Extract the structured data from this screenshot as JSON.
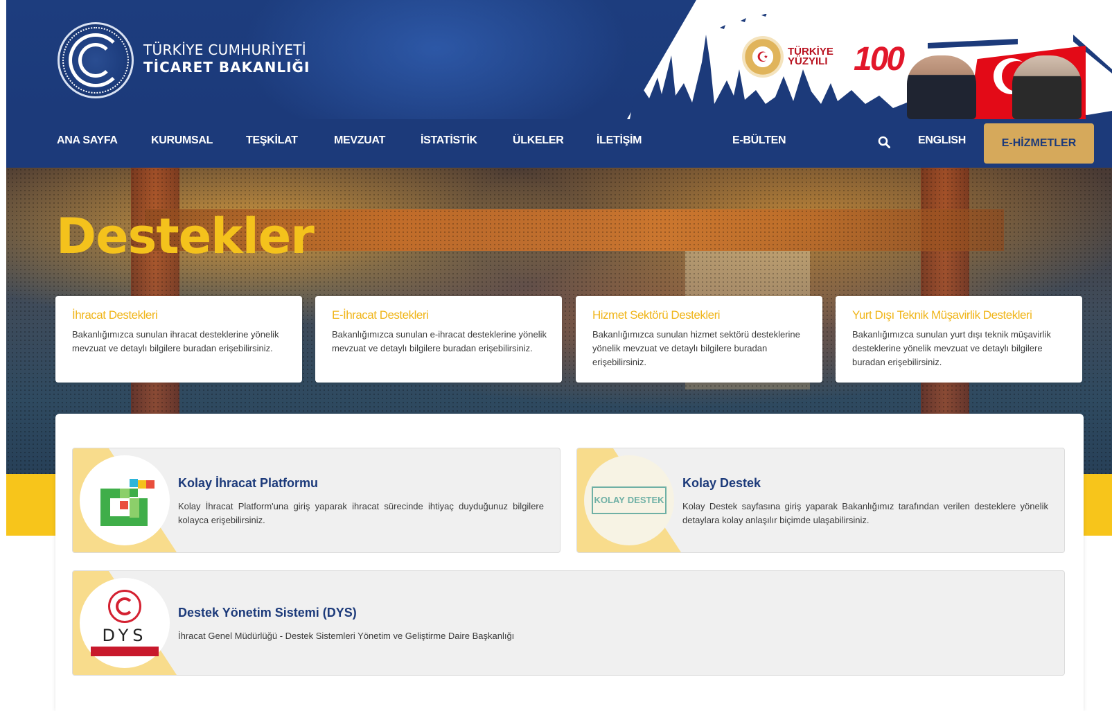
{
  "header": {
    "org_line1": "TÜRKİYE CUMHURİYETİ",
    "org_line2": "TİCARET BAKANLIĞI",
    "banner": {
      "badge_line1": "TÜRKİYE",
      "badge_line2": "YÜZYILI",
      "badge_number": "100"
    }
  },
  "nav": {
    "items": [
      {
        "label": "ANA SAYFA"
      },
      {
        "label": "KURUMSAL"
      },
      {
        "label": "TEŞKİLAT"
      },
      {
        "label": "MEVZUAT"
      },
      {
        "label": "İSTATİSTİK"
      },
      {
        "label": "ÜLKELER"
      },
      {
        "label": "İLETİŞİM"
      },
      {
        "label": "E-BÜLTEN"
      }
    ],
    "search_icon": "search-icon",
    "english": "ENGLISH",
    "ehizmetler": "E-HİZMETLER"
  },
  "hero": {
    "title": "Destekler"
  },
  "cards": [
    {
      "title": "İhracat Destekleri",
      "desc": "Bakanlığımızca sunulan ihracat desteklerine yönelik mevzuat ve detaylı bilgilere buradan erişebilirsiniz."
    },
    {
      "title": "E-İhracat Destekleri",
      "desc": "Bakanlığımızca sunulan e-ihracat desteklerine yönelik mevzuat ve detaylı bilgilere buradan erişebilirsiniz."
    },
    {
      "title": "Hizmet Sektörü Destekleri",
      "desc": "Bakanlığımızca sunulan hizmet sektörü desteklerine yönelik mevzuat ve detaylı bilgilere buradan erişebilirsiniz."
    },
    {
      "title": "Yurt Dışı Teknik Müşavirlik Destekleri",
      "desc": "Bakanlığımızca sunulan yurt dışı teknik müşavirlik desteklerine yönelik mevzuat ve detaylı bilgilere buradan erişebilirsiniz."
    }
  ],
  "platforms": [
    {
      "title": "Kolay İhracat Platformu",
      "desc": "Kolay İhracat Platform'una giriş yaparak ihracat sürecinde ihtiyaç duyduğunuz bilgilere kolayca erişebilirsiniz."
    },
    {
      "title": "Kolay Destek",
      "desc": "Kolay Destek sayfasına giriş yaparak Bakanlığımız tarafından verilen desteklere yönelik detaylara kolay anlaşılır biçimde ulaşabilirsiniz.",
      "logo_line1": "KOLAY",
      "logo_line2": "DESTEK"
    },
    {
      "title": "Destek Yönetim Sistemi (DYS)",
      "desc": "İhracat Genel Müdürlüğü - Destek Sistemleri Yönetim ve Geliştirme Daire Başkanlığı",
      "logo_text": "DYS"
    }
  ],
  "colors": {
    "navy": "#1c3a7a",
    "gold": "#d6a95b",
    "yellow": "#f7c51b",
    "card_title": "#f0b51a"
  }
}
